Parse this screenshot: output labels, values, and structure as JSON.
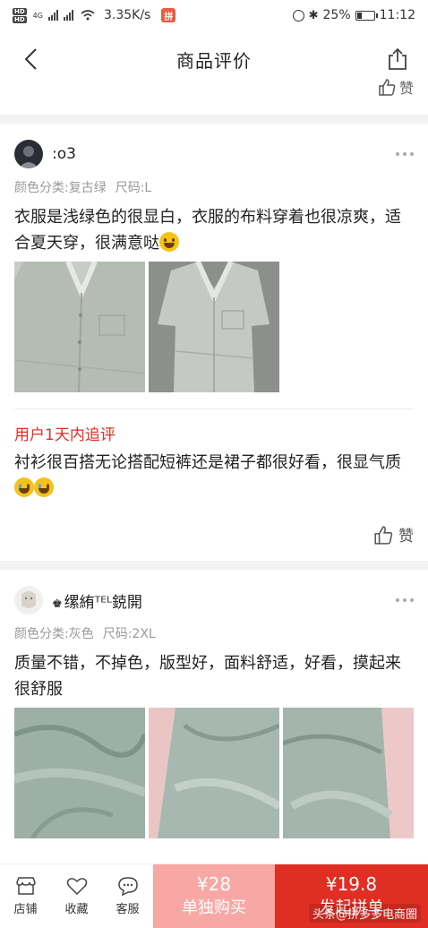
{
  "status_bar": {
    "network": "4G",
    "speed": "3.35K/s",
    "battery": "25%",
    "battery_level": 0.25,
    "time": "11:12"
  },
  "header": {
    "title": "商品评价"
  },
  "partial_like_label": "赞",
  "reviews": [
    {
      "user": ":o3",
      "color_spec": "颜色分类:复古绿",
      "size_spec": "尺码:L",
      "text": "衣服是浅绿色的很显白，衣服的布料穿着也很凉爽，适合夏天穿，很满意哒",
      "followup_title": "用户1天内追评",
      "followup_text": "衬衫很百搭无论搭配短裤还是裙子都很好看，很显气质",
      "like_label": "赞"
    },
    {
      "user": "缧絠ᵀᴱᴸ鋴開",
      "color_spec": "颜色分类:灰色",
      "size_spec": "尺码:2XL",
      "text": "质量不错，不掉色，版型好，面料舒适，好看，摸起来很舒服"
    }
  ],
  "bottom_bar": {
    "shop_label": "店铺",
    "favorite_label": "收藏",
    "service_label": "客服",
    "single_price": "¥28",
    "single_label": "单独购买",
    "group_price": "¥19.8",
    "group_label": "发起拼单",
    "watermark": "头条@拼多多电商圈"
  },
  "colors": {
    "accent": "#e02e24",
    "single_buy_bg": "#f8a8a4",
    "shirt_green": "#b8c4b8"
  }
}
